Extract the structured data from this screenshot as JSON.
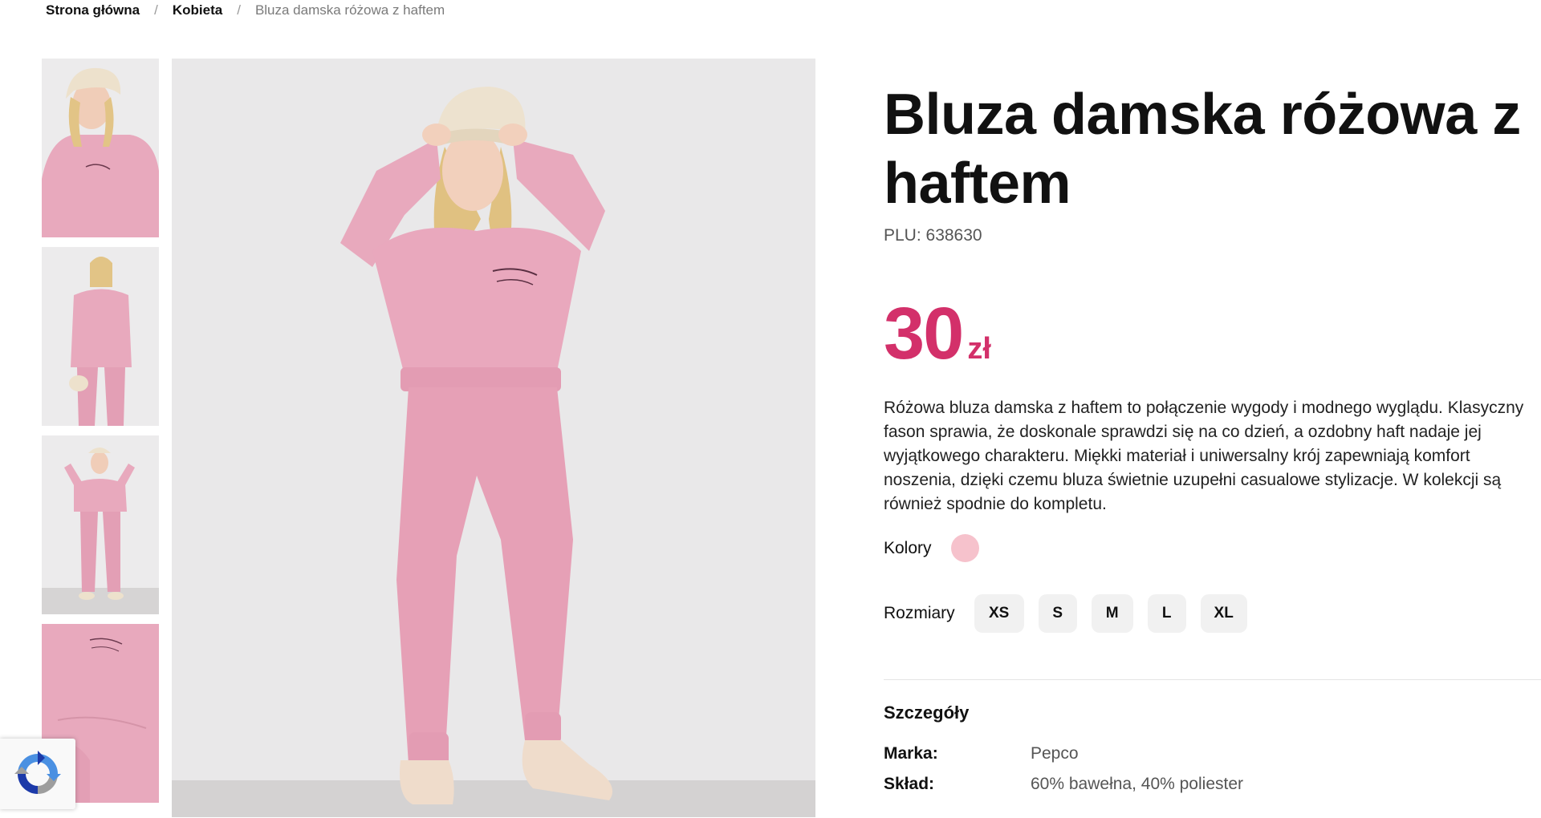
{
  "breadcrumb": {
    "home": "Strona główna",
    "category": "Kobieta",
    "current": "Bluza damska różowa z haftem",
    "separator": "/"
  },
  "gallery": {
    "thumbnails": [
      {
        "name": "thumb-portrait-closeup"
      },
      {
        "name": "thumb-full-front"
      },
      {
        "name": "thumb-full-hands-up"
      },
      {
        "name": "thumb-detail-embroidery"
      }
    ]
  },
  "product": {
    "title": "Bluza damska różowa z haftem",
    "plu": "PLU: 638630",
    "price_amount": "30",
    "price_currency": "zł",
    "description": "Różowa bluza damska z haftem to połączenie wygody i modnego wyglądu. Klasyczny fason sprawia, że doskonale sprawdzi się na co dzień, a ozdobny haft nadaje jej wyjątkowego charakteru. Miękki materiał i uniwersalny krój zapewniają komfort noszenia, dzięki czemu bluza świetnie uzupełni casualowe stylizacje. W kolekcji są również spodnie do kompletu.",
    "colors_label": "Kolory",
    "sizes_label": "Rozmiary",
    "sizes": [
      "XS",
      "S",
      "M",
      "L",
      "XL"
    ],
    "details_title": "Szczegóły",
    "details": [
      {
        "key": "Marka:",
        "value": "Pepco"
      },
      {
        "key": "Skład:",
        "value": "60% bawełna, 40% poliester"
      }
    ]
  },
  "colors": {
    "accent_price": "#d3306a",
    "swatch_pink": "#f6c2cc"
  }
}
